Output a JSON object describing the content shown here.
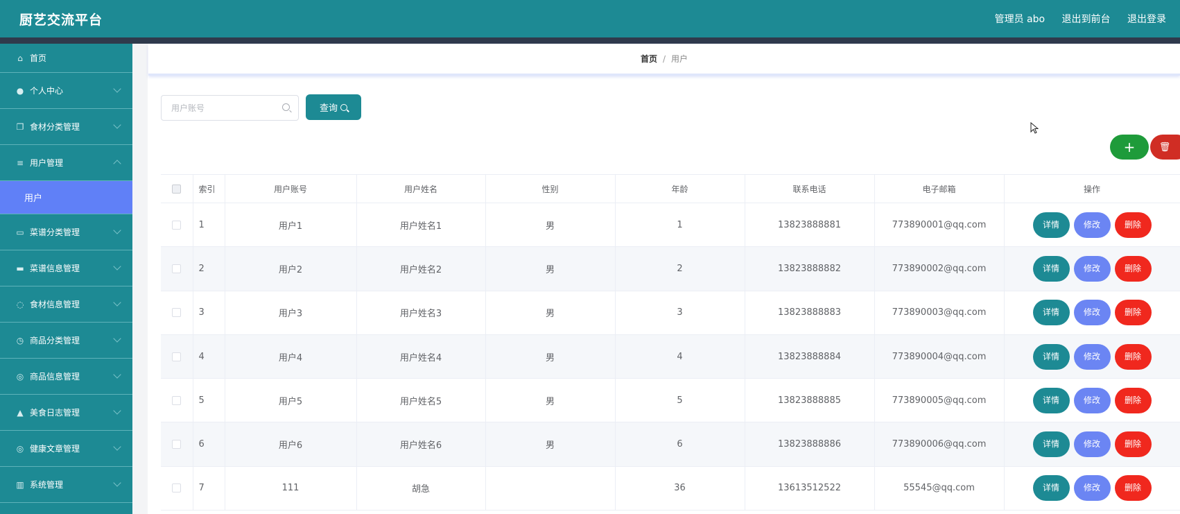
{
  "app": {
    "title": "厨艺交流平台",
    "user_label": "管理员 abo",
    "to_front_label": "退出到前台",
    "logout_label": "退出登录"
  },
  "sidebar": {
    "items": [
      {
        "label": "首页",
        "icon": "home-icon"
      },
      {
        "label": "个人中心",
        "icon": "user-icon"
      },
      {
        "label": "食材分类管理",
        "icon": "copy-icon"
      },
      {
        "label": "用户管理",
        "icon": "menu-icon"
      },
      {
        "label": "菜谱分类管理",
        "icon": "chat-icon"
      },
      {
        "label": "菜谱信息管理",
        "icon": "monitor-icon"
      },
      {
        "label": "食材信息管理",
        "icon": "power-icon"
      },
      {
        "label": "商品分类管理",
        "icon": "clock-icon"
      },
      {
        "label": "商品信息管理",
        "icon": "compass-icon"
      },
      {
        "label": "美食日志管理",
        "icon": "thumb-icon"
      },
      {
        "label": "健康文章管理",
        "icon": "compass-icon"
      },
      {
        "label": "系统管理",
        "icon": "chart-icon"
      }
    ],
    "active_sub": "用户"
  },
  "breadcrumb": {
    "home": "首页",
    "current": "用户"
  },
  "search": {
    "placeholder": "用户账号",
    "button_label": "查询"
  },
  "actions": {
    "add_label": "+"
  },
  "table": {
    "columns": [
      "索引",
      "用户账号",
      "用户姓名",
      "性别",
      "年龄",
      "联系电话",
      "电子邮箱",
      "操作"
    ],
    "rows": [
      {
        "index": "1",
        "account": "用户1",
        "name": "用户姓名1",
        "gender": "男",
        "age": "1",
        "phone": "13823888881",
        "email": "773890001@qq.com"
      },
      {
        "index": "2",
        "account": "用户2",
        "name": "用户姓名2",
        "gender": "男",
        "age": "2",
        "phone": "13823888882",
        "email": "773890002@qq.com"
      },
      {
        "index": "3",
        "account": "用户3",
        "name": "用户姓名3",
        "gender": "男",
        "age": "3",
        "phone": "13823888883",
        "email": "773890003@qq.com"
      },
      {
        "index": "4",
        "account": "用户4",
        "name": "用户姓名4",
        "gender": "男",
        "age": "4",
        "phone": "13823888884",
        "email": "773890004@qq.com"
      },
      {
        "index": "5",
        "account": "用户5",
        "name": "用户姓名5",
        "gender": "男",
        "age": "5",
        "phone": "13823888885",
        "email": "773890005@qq.com"
      },
      {
        "index": "6",
        "account": "用户6",
        "name": "用户姓名6",
        "gender": "男",
        "age": "6",
        "phone": "13823888886",
        "email": "773890006@qq.com"
      },
      {
        "index": "7",
        "account": "111",
        "name": "胡急",
        "gender": "",
        "age": "36",
        "phone": "13613512522",
        "email": "55545@qq.com"
      }
    ],
    "op_labels": {
      "detail": "详情",
      "edit": "修改",
      "delete": "删除"
    }
  }
}
